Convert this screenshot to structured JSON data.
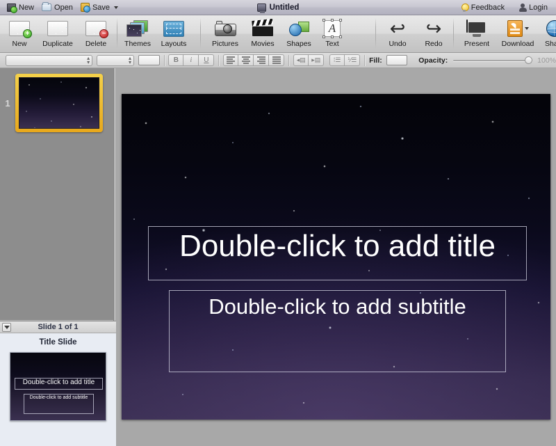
{
  "titlebar": {
    "document_title": "Untitled",
    "left_buttons": [
      {
        "label": "New",
        "icon": "new-document-icon"
      },
      {
        "label": "Open",
        "icon": "open-folder-icon"
      },
      {
        "label": "Save",
        "icon": "save-floppy-icon",
        "has_menu": true
      }
    ],
    "right_buttons": [
      {
        "label": "Feedback",
        "icon": "lightbulb-icon"
      },
      {
        "label": "Login",
        "icon": "person-icon"
      }
    ]
  },
  "toolbar": {
    "items": [
      {
        "label": "New",
        "icon": "slide-add-icon"
      },
      {
        "label": "Duplicate",
        "icon": "slide-duplicate-icon"
      },
      {
        "label": "Delete",
        "icon": "slide-delete-icon"
      },
      {
        "label": "Themes",
        "icon": "themes-icon"
      },
      {
        "label": "Layouts",
        "icon": "layouts-icon"
      },
      {
        "label": "Pictures",
        "icon": "camera-icon"
      },
      {
        "label": "Movies",
        "icon": "clapperboard-icon"
      },
      {
        "label": "Shapes",
        "icon": "shapes-icon"
      },
      {
        "label": "Text",
        "icon": "text-box-icon"
      },
      {
        "label": "Undo",
        "icon": "undo-arrow-icon"
      },
      {
        "label": "Redo",
        "icon": "redo-arrow-icon"
      },
      {
        "label": "Present",
        "icon": "monitor-icon"
      },
      {
        "label": "Download",
        "icon": "download-icon"
      },
      {
        "label": "Share",
        "icon": "globe-icon"
      }
    ]
  },
  "formatbar": {
    "font_family_value": "",
    "font_size_value": "",
    "text_color_label": "",
    "bold_label": "B",
    "italic_label": "i",
    "underline_label": "U",
    "fill_label": "Fill:",
    "opacity_label": "Opacity:",
    "opacity_value": "100%",
    "align_buttons": [
      "align-left",
      "align-center",
      "align-right",
      "align-justify"
    ],
    "indent_buttons": [
      "decrease-indent",
      "increase-indent"
    ],
    "list_buttons": [
      "bullet-list",
      "numbered-list"
    ]
  },
  "sidebar": {
    "slides": [
      {
        "number": "1",
        "selected": true
      }
    ]
  },
  "inspector": {
    "header_title": "Slide 1 of 1",
    "layout_name": "Title Slide",
    "preview": {
      "title_text": "Double-click to add title",
      "subtitle_text": "Double-click to add subtitle"
    }
  },
  "canvas": {
    "title_placeholder": "Double-click to add title",
    "subtitle_placeholder": "Double-click to add subtitle"
  },
  "colors": {
    "selection_gold": "#e8a81c",
    "slide_bg_top": "#040409",
    "slide_bg_bottom": "#352b4d",
    "titlebar_bg": "#c9c8d2",
    "toolbar_bg": "#dcdcdc",
    "canvas_bg": "#a8a8a8",
    "sidebar_bg": "#8d8d8d",
    "inspector_bg": "#e8ecf3"
  }
}
